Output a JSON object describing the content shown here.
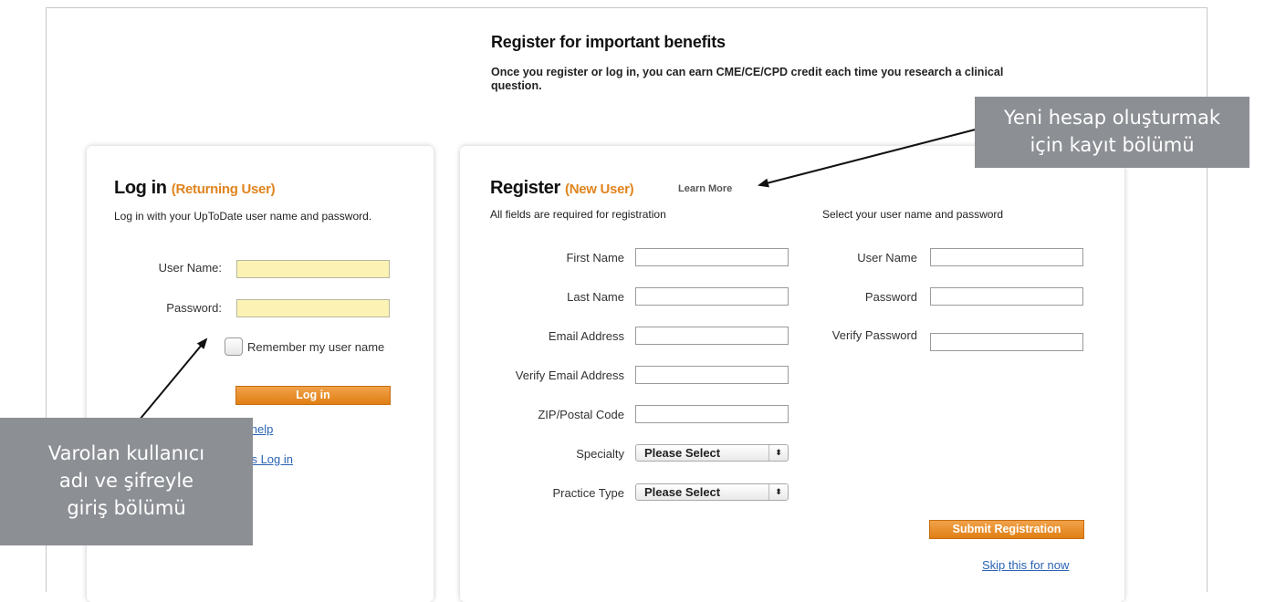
{
  "header": {
    "title": "Register for important benefits",
    "subtitle": "Once you register or log in, you can earn CME/CE/CPD credit each time you research a clinical question."
  },
  "login": {
    "title": "Log in",
    "title_sub": "(Returning User)",
    "description": "Log in with your UpToDate user name and password.",
    "username_label": "User Name:",
    "username_value": "",
    "password_label": "Password:",
    "password_value": "",
    "remember_label": "Remember my user name",
    "remember_checked": false,
    "login_button": "Log in",
    "help_link": "in help",
    "athens_link": "ens Log in"
  },
  "register": {
    "title": "Register",
    "title_sub": "(New User)",
    "learn_more": "Learn More",
    "required_note": "All fields are required for registration",
    "credentials_note": "Select your user name and password",
    "first_name_label": "First Name",
    "last_name_label": "Last Name",
    "email_label": "Email Address",
    "verify_email_label": "Verify Email Address",
    "zip_label": "ZIP/Postal Code",
    "specialty_label": "Specialty",
    "specialty_value": "Please Select",
    "practice_label": "Practice Type",
    "practice_value": "Please Select",
    "user_name_label": "User Name",
    "password_label": "Password",
    "verify_password_label": "Verify Password",
    "submit_button": "Submit Registration",
    "skip_link": "Skip this for now"
  },
  "annotations": {
    "left": [
      "Varolan kullanıcı",
      "adı ve şifreyle",
      "giriş bölümü"
    ],
    "right": [
      "Yeni hesap oluşturmak",
      "için kayıt bölümü"
    ]
  },
  "colors": {
    "accent_orange": "#e0841e",
    "input_yellow": "#fbf2b4",
    "link_blue": "#2a63b4",
    "callout_gray": "#8c8f94"
  },
  "icons": {
    "select_arrows": "⬍"
  }
}
